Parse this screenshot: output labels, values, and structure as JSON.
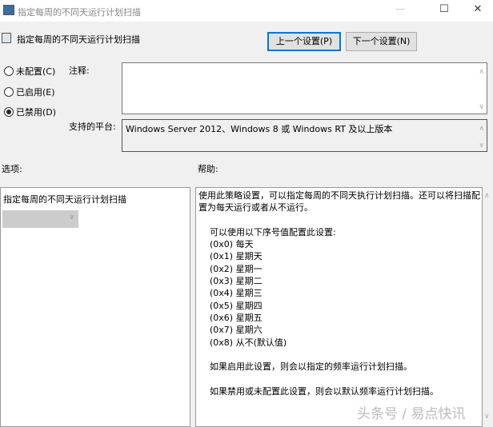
{
  "window": {
    "title": "指定每周的不同天运行计划扫描",
    "minimize": "—",
    "maximize": "☐",
    "close": "✕"
  },
  "header": {
    "title": "指定每周的不同天运行计划扫描",
    "prev_button": "上一个设置(P)",
    "next_button": "下一个设置(N)"
  },
  "state": {
    "options": [
      {
        "label": "未配置(C)",
        "selected": false
      },
      {
        "label": "已启用(E)",
        "selected": false
      },
      {
        "label": "已禁用(D)",
        "selected": true
      }
    ]
  },
  "comment": {
    "label": "注释:",
    "value": ""
  },
  "platform": {
    "label": "支持的平台:",
    "value": "Windows Server 2012、Windows 8 或 Windows RT 及以上版本"
  },
  "options_panel": {
    "label": "选项:",
    "setting_label": "指定每周的不同天运行计划扫描",
    "dropdown_value": ""
  },
  "help": {
    "label": "帮助:",
    "lines": [
      "使用此策略设置，可以指定每周的不同天执行计划扫描。还可以将扫描配",
      "置为每天运行或者从不运行。",
      "",
      "    可以使用以下序号值配置此设置:",
      "    (0x0) 每天",
      "    (0x1) 星期天",
      "    (0x2) 星期一",
      "    (0x3) 星期二",
      "    (0x4) 星期三",
      "    (0x5) 星期四",
      "    (0x6) 星期五",
      "    (0x7) 星期六",
      "    (0x8) 从不(默认值)",
      "",
      "    如果启用此设置，则会以指定的频率运行计划扫描。",
      "",
      "    如果禁用或未配置此设置，则会以默认频率运行计划扫描。"
    ]
  },
  "watermark": "头条号 / 易点快讯"
}
